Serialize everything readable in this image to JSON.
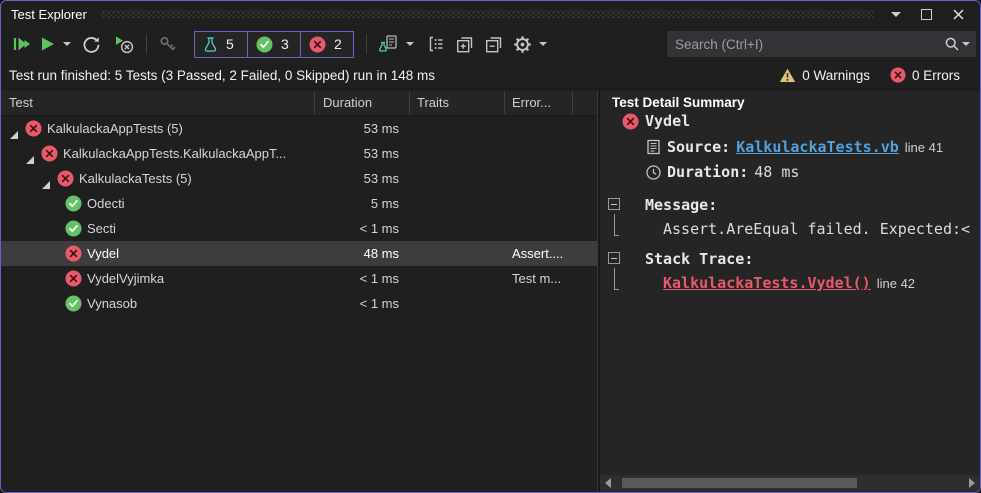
{
  "window": {
    "title": "Test Explorer"
  },
  "toolbar": {
    "filter_total": {
      "count": "5"
    },
    "filter_passed": {
      "count": "3"
    },
    "filter_failed": {
      "count": "2"
    },
    "search": {
      "placeholder": "Search (Ctrl+I)"
    }
  },
  "status": {
    "summary": "Test run finished: 5 Tests (3 Passed, 2 Failed, 0 Skipped) run in 148 ms",
    "warnings": "0 Warnings",
    "errors": "0 Errors"
  },
  "table": {
    "columns": [
      "Test",
      "Duration",
      "Traits",
      "Error..."
    ],
    "rows": [
      {
        "name": "KalkulackaAppTests  (5)",
        "duration": "53 ms",
        "traits": "",
        "error": "",
        "level": 0,
        "status": "failed",
        "expandable": true,
        "selected": false
      },
      {
        "name": "KalkulackaAppTests.KalkulackaAppT...",
        "duration": "53 ms",
        "traits": "",
        "error": "",
        "level": 1,
        "status": "failed",
        "expandable": true,
        "selected": false
      },
      {
        "name": "KalkulackaTests  (5)",
        "duration": "53 ms",
        "traits": "",
        "error": "",
        "level": 2,
        "status": "failed",
        "expandable": true,
        "selected": false
      },
      {
        "name": "Odecti",
        "duration": "5 ms",
        "traits": "",
        "error": "",
        "level": 3,
        "status": "passed",
        "expandable": false,
        "selected": false
      },
      {
        "name": "Secti",
        "duration": "< 1 ms",
        "traits": "",
        "error": "",
        "level": 3,
        "status": "passed",
        "expandable": false,
        "selected": false
      },
      {
        "name": "Vydel",
        "duration": "48 ms",
        "traits": "",
        "error": "Assert....",
        "level": 3,
        "status": "failed",
        "expandable": false,
        "selected": true
      },
      {
        "name": "VydelVyjimka",
        "duration": "< 1 ms",
        "traits": "",
        "error": "Test m...",
        "level": 3,
        "status": "failed",
        "expandable": false,
        "selected": false
      },
      {
        "name": "Vynasob",
        "duration": "< 1 ms",
        "traits": "",
        "error": "",
        "level": 3,
        "status": "passed",
        "expandable": false,
        "selected": false
      }
    ]
  },
  "detail": {
    "title": "Test Detail Summary",
    "test_name": "Vydel",
    "source_label": "Source:",
    "source_link": "KalkulackaTests.vb",
    "source_line": "line 41",
    "duration_label": "Duration:",
    "duration_value": "48 ms",
    "message_label": "Message:",
    "message_text": "Assert.AreEqual failed. Expected:<",
    "stack_label": "Stack Trace:",
    "stack_link": "KalkulackaTests.Vydel()",
    "stack_line": "line 42"
  },
  "colors": {
    "accent_purple": "#6c5fc7",
    "passed_green": "#66c266",
    "failed_red": "#e8596a",
    "beaker_teal": "#58cab8",
    "warning_yellow": "#e2c07c",
    "link_blue": "#55a0da",
    "background": "#1f1f1f",
    "panel": "#252526",
    "selection": "#3d3d3f"
  }
}
